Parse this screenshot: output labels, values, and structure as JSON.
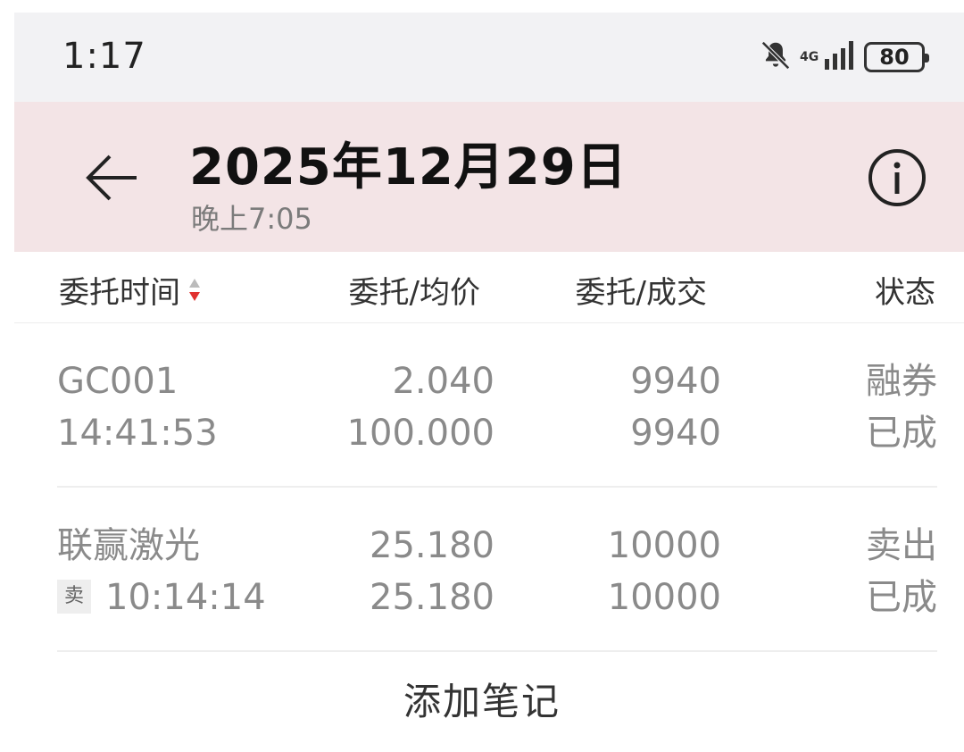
{
  "status_bar": {
    "time": "1:17",
    "network": "4G",
    "battery": "80",
    "icons": [
      "bell-off-icon",
      "signal-icon",
      "battery-icon"
    ]
  },
  "header": {
    "title": "2025年12月29日",
    "subtitle": "晚上7:05",
    "background": "#f3e4e6",
    "icons": [
      "back-arrow-icon",
      "info-icon"
    ]
  },
  "columns": {
    "time": "委托时间",
    "price": "委托/均价",
    "qty": "委托/成交",
    "status": "状态",
    "sort_accent": "#e0312f"
  },
  "orders": [
    {
      "name": "GC001",
      "time": "14:41:53",
      "price": "2.040",
      "avg_price": "100.000",
      "qty": "9940",
      "filled": "9940",
      "status_line1": "融券",
      "status_line2": "已成"
    },
    {
      "name": "联赢激光",
      "tag": "卖",
      "time": "10:14:14",
      "price": "25.180",
      "avg_price": "25.180",
      "qty": "10000",
      "filled": "10000",
      "status_line1": "卖出",
      "status_line2": "已成"
    }
  ],
  "add_note": "添加笔记"
}
